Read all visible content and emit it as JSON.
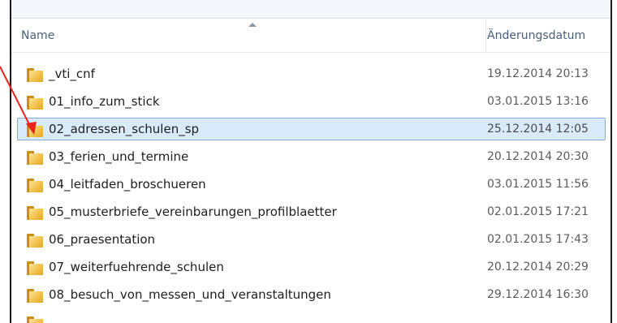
{
  "header": {
    "name_label": "Name",
    "date_label": "Änderungsdatum"
  },
  "files": [
    {
      "name": "_vti_cnf",
      "date": "19.12.2014 20:13"
    },
    {
      "name": "01_info_zum_stick",
      "date": "03.01.2015 13:16"
    },
    {
      "name": "02_adressen_schulen_sp",
      "date": "25.12.2014 12:05",
      "selected": true
    },
    {
      "name": "03_ferien_und_termine",
      "date": "20.12.2014 20:30"
    },
    {
      "name": "04_leitfaden_broschueren",
      "date": "03.01.2015 11:56"
    },
    {
      "name": "05_musterbriefe_vereinbarungen_profilblaetter",
      "date": "02.01.2015 17:21"
    },
    {
      "name": "06_praesentation",
      "date": "02.01.2015 17:43"
    },
    {
      "name": "07_weiterfuehrende_schulen",
      "date": "20.12.2014 20:29"
    },
    {
      "name": "08_besuch_von_messen_und_veranstaltungen",
      "date": "29.12.2014 16:30"
    }
  ],
  "colors": {
    "selection_bg": "#d9ebfb",
    "selection_border": "#84acd9",
    "annotation_arrow": "#e8221c",
    "folder_yellow": "#f2c24c"
  }
}
